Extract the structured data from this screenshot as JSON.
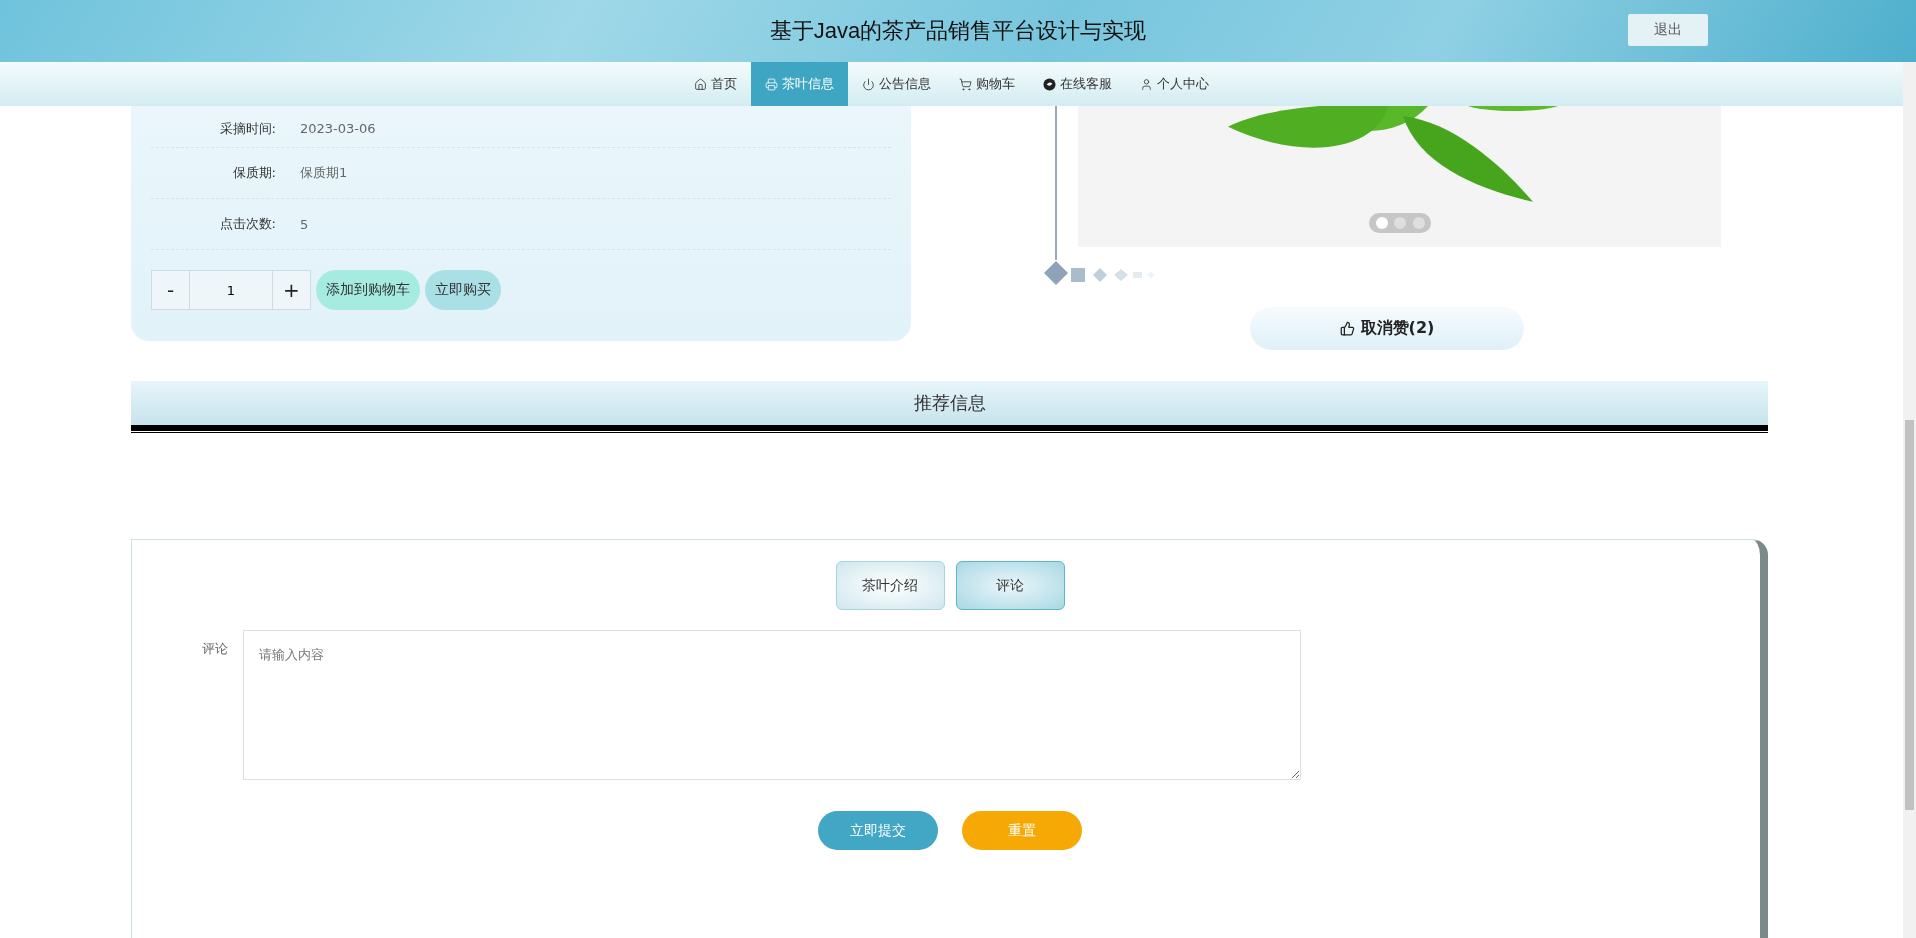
{
  "header": {
    "title": "基于Java的茶产品销售平台设计与实现",
    "logout": "退出"
  },
  "nav": [
    {
      "label": "首页",
      "selected": false
    },
    {
      "label": "茶叶信息",
      "selected": true
    },
    {
      "label": "公告信息",
      "selected": false
    },
    {
      "label": "购物车",
      "selected": false
    },
    {
      "label": "在线客服",
      "selected": false
    },
    {
      "label": "个人中心",
      "selected": false
    }
  ],
  "details": [
    {
      "label": "采摘时间:",
      "value": "2023-03-06"
    },
    {
      "label": "保质期:",
      "value": "保质期1"
    },
    {
      "label": "点击次数:",
      "value": "5"
    }
  ],
  "quantity": {
    "minus": "-",
    "value": "1",
    "plus": "+"
  },
  "actions": [
    "添加到购物车",
    "立即购买"
  ],
  "carousel": {
    "dots": [
      {
        "selected": true
      },
      {
        "selected": false
      },
      {
        "selected": false
      }
    ]
  },
  "like_button": "取消赞(2)",
  "recommend_title": "推荐信息",
  "tabs": [
    {
      "label": "茶叶介绍",
      "selected": false
    },
    {
      "label": "评论",
      "selected": true
    }
  ],
  "comment_form": {
    "label": "评论",
    "placeholder": "请输入内容",
    "submit": "立即提交",
    "reset": "重置"
  }
}
